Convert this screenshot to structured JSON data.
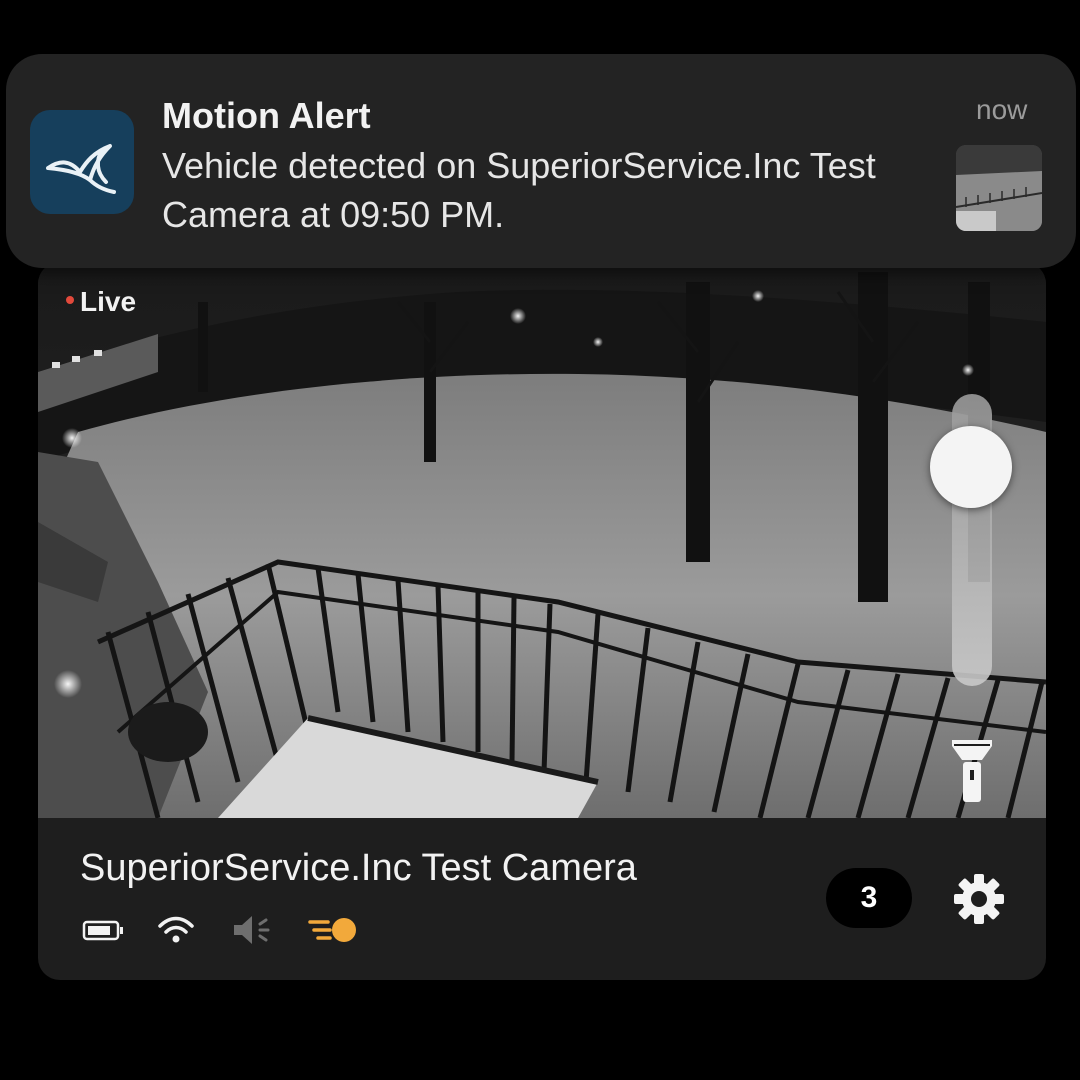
{
  "notification": {
    "title": "Motion Alert",
    "body": "Vehicle detected on SuperiorService.Inc Test Camera at 09:50 PM.",
    "time": "now",
    "app_icon": "bird-logo-icon",
    "thumbnail": "camera-snapshot-thumbnail"
  },
  "camera": {
    "live_label": "Live",
    "name": "SuperiorService.Inc Test Camera",
    "event_count": "3",
    "zoom_slider_level": 0.75,
    "status_icons": [
      "battery-icon",
      "wifi-icon",
      "speaker-muted-icon",
      "spotlight-icon"
    ],
    "colors": {
      "live_dot": "#e2493b",
      "spotlight_accent": "#f2a93b",
      "card_background": "#1e1e1e",
      "notification_background": "#232323",
      "app_icon_background": "#163f5c"
    }
  }
}
